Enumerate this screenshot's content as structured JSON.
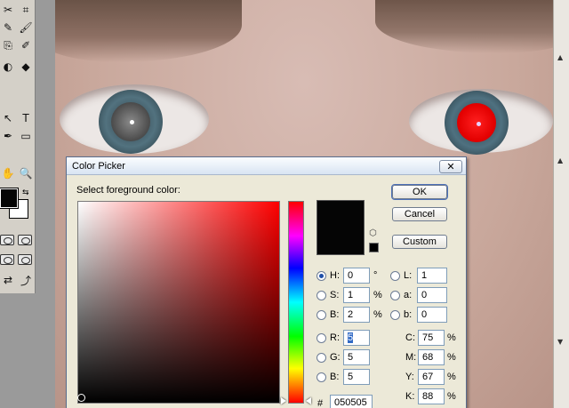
{
  "toolbox": {
    "tools": [
      "✂",
      "⌗",
      "✎",
      "🖌",
      "⎘",
      "✐",
      "◐",
      "◆",
      "↖",
      "T",
      "✒",
      "▭",
      "✋",
      "🔍"
    ]
  },
  "dialog": {
    "title": "Color Picker",
    "prompt": "Select foreground color:",
    "close_glyph": "✕",
    "buttons": {
      "ok": "OK",
      "cancel": "Cancel",
      "custom": "Custom"
    },
    "hsb": [
      {
        "label": "H:",
        "value": "0",
        "unit": "°",
        "selected": true
      },
      {
        "label": "S:",
        "value": "1",
        "unit": "%",
        "selected": false
      },
      {
        "label": "B:",
        "value": "2",
        "unit": "%",
        "selected": false
      }
    ],
    "lab": [
      {
        "label": "L:",
        "value": "1"
      },
      {
        "label": "a:",
        "value": "0"
      },
      {
        "label": "b:",
        "value": "0"
      }
    ],
    "rgb": [
      {
        "label": "R:",
        "value": "5"
      },
      {
        "label": "G:",
        "value": "5"
      },
      {
        "label": "B:",
        "value": "5"
      }
    ],
    "cmyk": [
      {
        "label": "C:",
        "value": "75",
        "unit": "%"
      },
      {
        "label": "M:",
        "value": "68",
        "unit": "%"
      },
      {
        "label": "Y:",
        "value": "67",
        "unit": "%"
      },
      {
        "label": "K:",
        "value": "88",
        "unit": "%"
      }
    ],
    "hex_label": "#",
    "hex": "050505",
    "colors": {
      "new": "#050505",
      "current": "#050505"
    }
  }
}
